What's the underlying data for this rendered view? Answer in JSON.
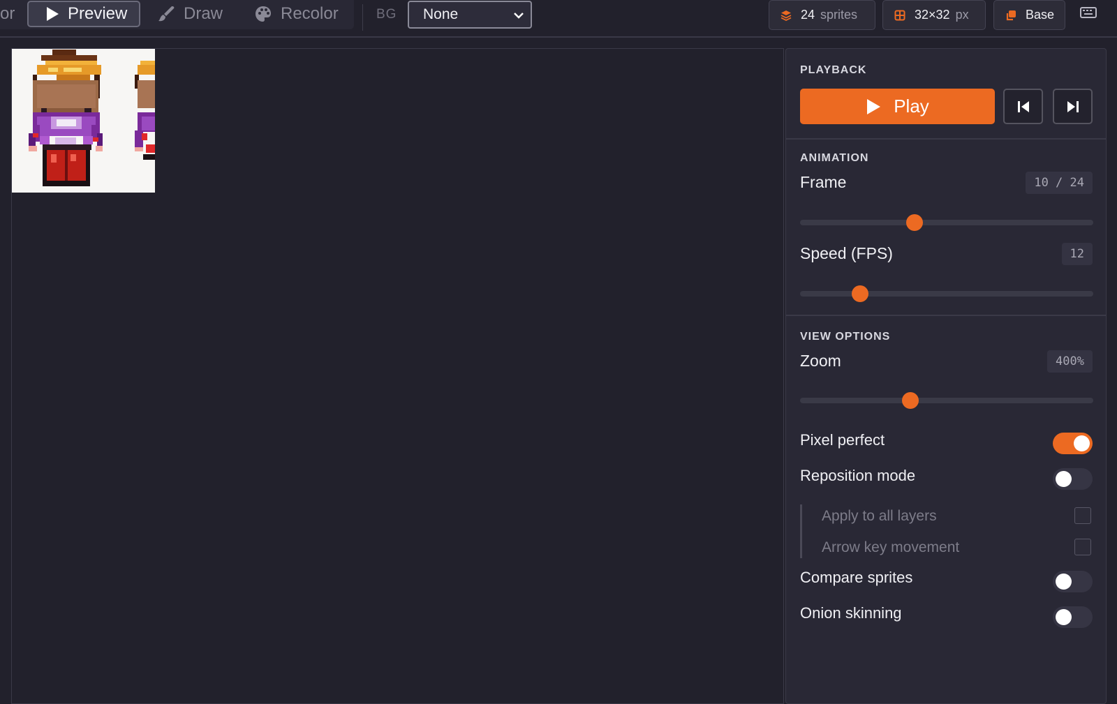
{
  "toolbar": {
    "cut_label": "or",
    "modes": [
      {
        "label": "Preview",
        "icon": "play-icon",
        "active": true
      },
      {
        "label": "Draw",
        "icon": "brush-icon",
        "active": false
      },
      {
        "label": "Recolor",
        "icon": "palette-icon",
        "active": false
      }
    ],
    "bg_label": "BG",
    "bg_value": "None",
    "sprites_count": "24",
    "sprites_label": "sprites",
    "size_value": "32×32",
    "size_unit": "px",
    "layer_label": "Base",
    "accent_color": "#ec6a22"
  },
  "panel": {
    "playback": {
      "title": "PLAYBACK",
      "play_label": "Play"
    },
    "animation": {
      "title": "ANIMATION",
      "frame_label": "Frame",
      "frame_value": "10 / 24",
      "frame_fraction": 0.39,
      "speed_label": "Speed (FPS)",
      "speed_value": "12",
      "speed_fraction": 0.205
    },
    "view": {
      "title": "VIEW OPTIONS",
      "zoom_label": "Zoom",
      "zoom_value": "400%",
      "zoom_fraction": 0.375,
      "toggles": [
        {
          "label": "Pixel perfect",
          "on": true
        },
        {
          "label": "Reposition mode",
          "on": false
        }
      ],
      "sub_options": [
        {
          "label": "Apply to all layers",
          "checked": false
        },
        {
          "label": "Arrow key movement",
          "checked": false
        }
      ],
      "toggles_after": [
        {
          "label": "Compare sprites",
          "on": false
        },
        {
          "label": "Onion skinning",
          "on": false
        }
      ]
    }
  }
}
